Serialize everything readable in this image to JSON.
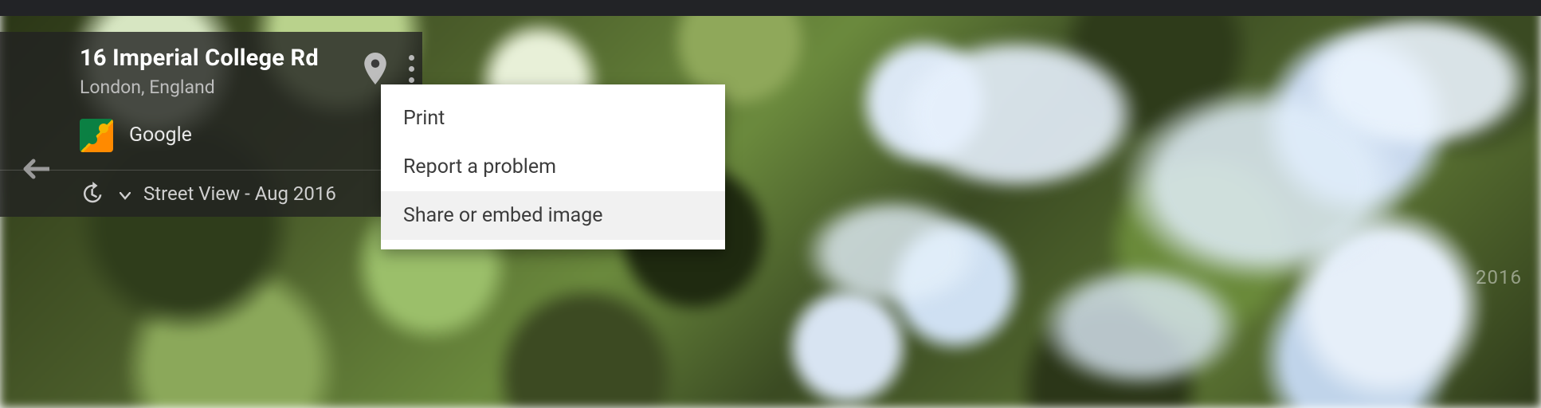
{
  "location": {
    "address": "16 Imperial College Rd",
    "region": "London, England"
  },
  "source": {
    "name": "Google"
  },
  "timeline": {
    "label": "Street View - Aug 2016"
  },
  "menu": {
    "items": [
      {
        "label": "Print",
        "hover": false
      },
      {
        "label": "Report a problem",
        "hover": false
      },
      {
        "label": "Share or embed image",
        "hover": true
      }
    ]
  },
  "watermark": "2016"
}
